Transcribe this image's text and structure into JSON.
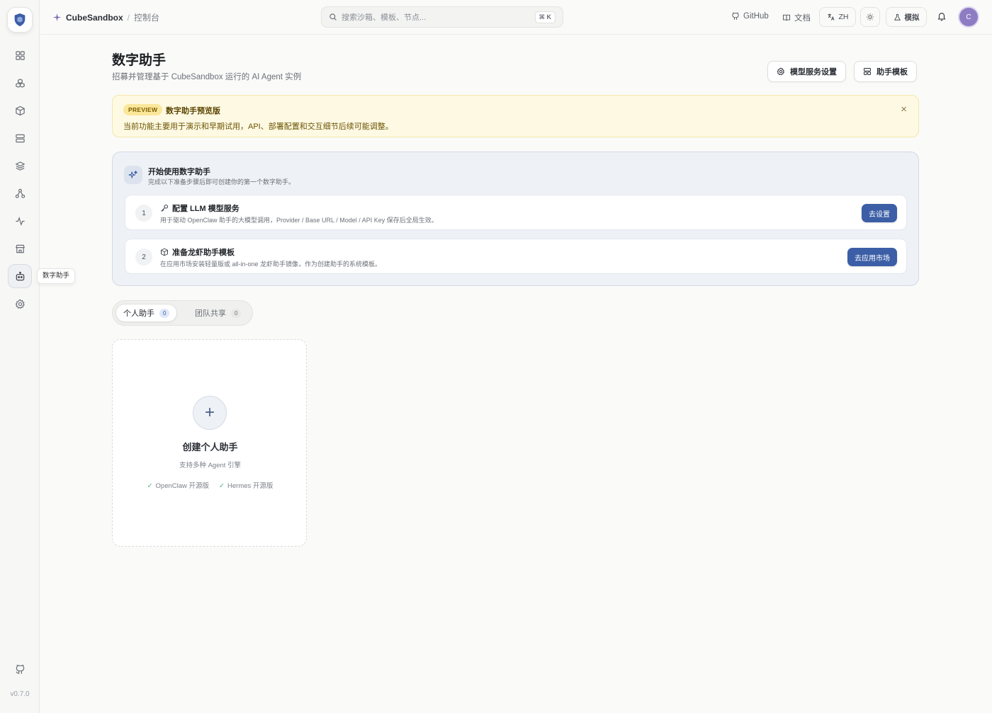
{
  "app": {
    "brand": "CubeSandbox",
    "breadcrumb_page": "控制台",
    "version": "v0.7.0"
  },
  "search": {
    "placeholder": "搜索沙箱、模板、节点...",
    "shortcut": "⌘ K"
  },
  "topbar": {
    "github": "GitHub",
    "docs": "文档",
    "lang": "ZH",
    "mode_label": "模拟",
    "avatar_initial": "C"
  },
  "sidebar": {
    "items": [
      {
        "name": "dashboard",
        "icon": "grid-icon"
      },
      {
        "name": "sandboxes",
        "icon": "cubes-icon"
      },
      {
        "name": "templates",
        "icon": "box-icon"
      },
      {
        "name": "nodes",
        "icon": "server-icon"
      },
      {
        "name": "layers",
        "icon": "layers-icon"
      },
      {
        "name": "network",
        "icon": "network-icon"
      },
      {
        "name": "monitor",
        "icon": "activity-icon"
      },
      {
        "name": "store",
        "icon": "store-icon"
      },
      {
        "name": "assistants",
        "icon": "bot-icon",
        "active": true
      },
      {
        "name": "settings",
        "icon": "gear-icon"
      }
    ],
    "tooltip": "数字助手"
  },
  "page": {
    "title": "数字助手",
    "subtitle": "招募并管理基于 CubeSandbox 运行的 AI Agent 实例",
    "btn_model_settings": "模型服务设置",
    "btn_templates": "助手模板"
  },
  "banner": {
    "badge": "PREVIEW",
    "title": "数字助手预览版",
    "desc": "当前功能主要用于演示和早期试用，API、部署配置和交互细节后续可能调整。",
    "close": "×"
  },
  "guide": {
    "title": "开始使用数字助手",
    "desc": "完成以下准备步骤后即可创建你的第一个数字助手。",
    "steps": [
      {
        "num": "1",
        "title": "配置 LLM 模型服务",
        "desc": "用于驱动 OpenClaw 助手的大模型调用，Provider / Base URL / Model / API Key 保存后全局生效。",
        "button": "去设置"
      },
      {
        "num": "2",
        "title": "准备龙虾助手模板",
        "desc": "在应用市场安装轻量版或 all-in-one 龙虾助手镜像，作为创建助手的系统模板。",
        "button": "去应用市场"
      }
    ]
  },
  "tabs": [
    {
      "label": "个人助手",
      "count": "0"
    },
    {
      "label": "团队共享",
      "count": "0"
    }
  ],
  "create_card": {
    "plus": "+",
    "title": "创建个人助手",
    "desc": "支持多种 Agent 引擎",
    "features": [
      "OpenClaw 开源版",
      "Hermes 开源版"
    ]
  },
  "colors": {
    "accent": "#3b5ea6",
    "banner_bg": "#fef9e3",
    "avatar": "#8e7cc3"
  }
}
